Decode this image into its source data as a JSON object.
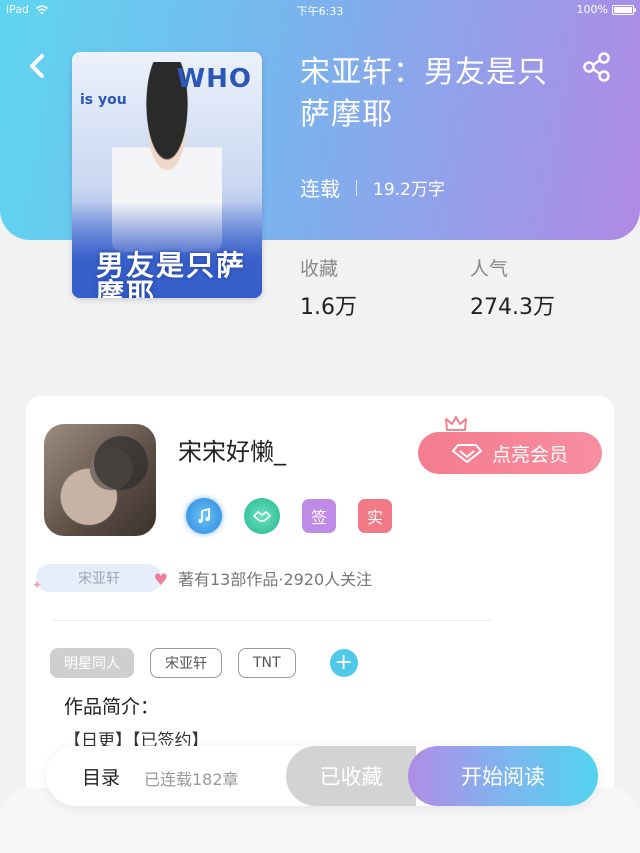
{
  "status_bar": {
    "device": "iPad",
    "time": "下午6:33",
    "battery": "100%"
  },
  "book": {
    "title": "宋亚轩：男友是只萨摩耶",
    "status": "连载",
    "word_count": "19.2万字",
    "cover": {
      "headline": "WHO",
      "subline": "is you",
      "title_art": "男友是只萨摩耶"
    }
  },
  "stats": {
    "favorites_label": "收藏",
    "favorites_value": "1.6万",
    "popularity_label": "人气",
    "popularity_value": "274.3万"
  },
  "author": {
    "name": "宋宋好懒_",
    "vip_button": "点亮会员",
    "badge_sign": "签",
    "badge_real": "实",
    "tag": "宋亚轩",
    "works_info": "著有13部作品·2920人关注"
  },
  "tags": [
    "明星同人",
    "宋亚轩",
    "TNT"
  ],
  "tag_add": "+",
  "intro": {
    "label": "作品简介：",
    "text": "【日更】【已签约】"
  },
  "bottom_bar": {
    "toc": "目录",
    "chapters": "已连载182章",
    "collected": "已收藏",
    "read": "开始阅读"
  },
  "colors": {
    "gradient_start": "#5fd6f0",
    "gradient_end": "#b08ae6",
    "vip_pink": "#f47c8e",
    "add_blue": "#4fc8ec"
  },
  "icons": {
    "back": "back-chevron-icon",
    "share": "share-icon",
    "wifi": "wifi-icon",
    "battery": "battery-icon",
    "crown": "crown-icon",
    "diamond": "diamond-icon"
  }
}
